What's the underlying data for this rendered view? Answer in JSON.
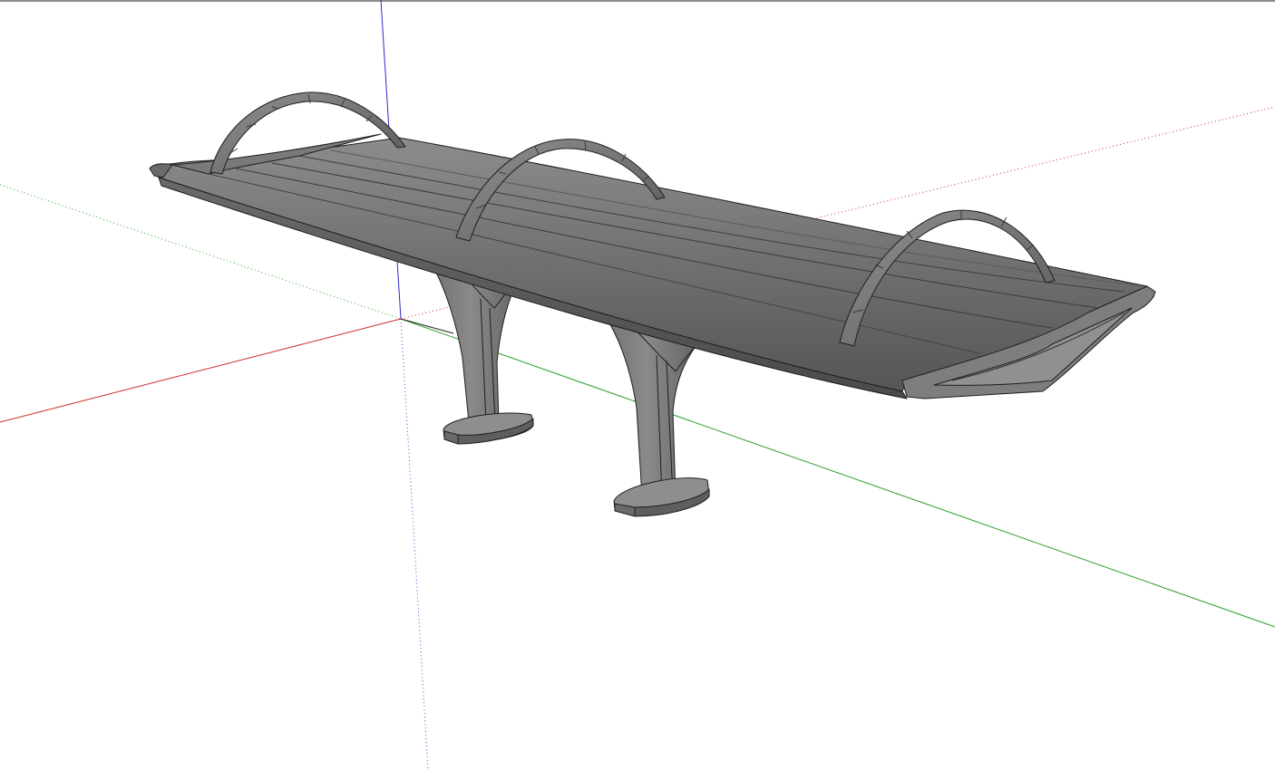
{
  "viewport": {
    "background_color": "#ffffff",
    "model": "bench"
  },
  "axes": {
    "red_axis_color": "#cc2a2a",
    "green_axis_color": "#2aa02a",
    "blue_axis_color": "#2a2acc"
  },
  "model_colors": {
    "face_light": "#8a8a8a",
    "face_mid": "#6e6e6e",
    "face_dark": "#4e4e4e",
    "edge": "#1e1e1e"
  }
}
